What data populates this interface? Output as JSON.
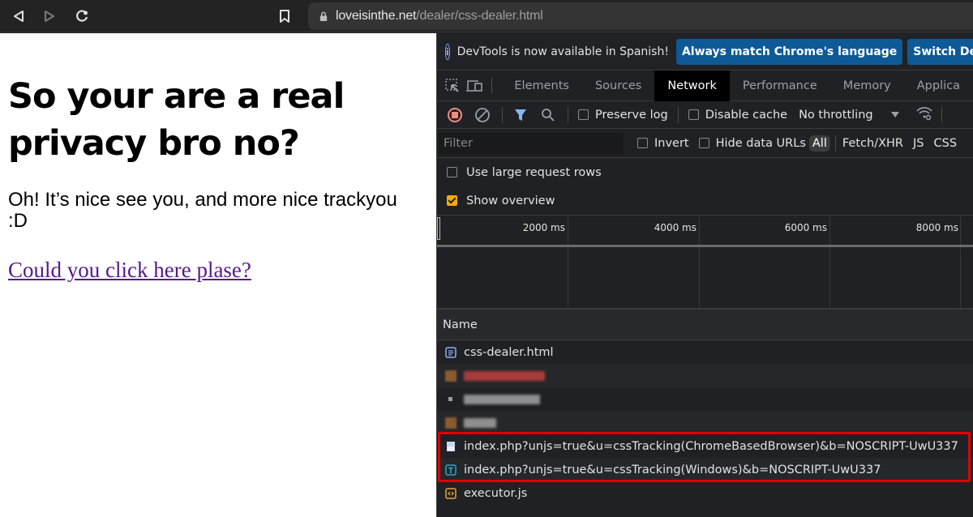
{
  "browser": {
    "url_host": "loveisinthe.net",
    "url_path": "/dealer/css-dealer.html",
    "icons": [
      "back-icon",
      "forward-icon",
      "reload-icon",
      "bookmark-icon",
      "lock-icon"
    ]
  },
  "page": {
    "heading": "So your are a real privacy bro no?",
    "paragraph": "Oh! It’s nice see you, and more nice trackyou :D",
    "link": "Could you click here plase?"
  },
  "devtools": {
    "infobar": {
      "message": "DevTools is now available in Spanish!",
      "btn_match": "Always match Chrome's language",
      "btn_switch": "Switch De"
    },
    "tabs": [
      {
        "label": "Elements"
      },
      {
        "label": "Sources"
      },
      {
        "label": "Network",
        "active": true
      },
      {
        "label": "Performance"
      },
      {
        "label": "Memory"
      },
      {
        "label": "Applica"
      }
    ],
    "toolbar": {
      "preserve_log": "Preserve log",
      "preserve_log_checked": false,
      "disable_cache": "Disable cache",
      "disable_cache_checked": false,
      "throttling": "No throttling"
    },
    "filter": {
      "placeholder": "Filter",
      "invert": "Invert",
      "hide_data_urls": "Hide data URLs",
      "types": [
        "All",
        "Fetch/XHR",
        "JS",
        "CSS"
      ],
      "active_type": "All"
    },
    "settings": {
      "large_rows": "Use large request rows",
      "large_rows_checked": false,
      "show_overview": "Show overview",
      "show_overview_checked": true
    },
    "overview": {
      "ticks": [
        "2000 ms",
        "4000 ms",
        "6000 ms",
        "8000 ms"
      ]
    },
    "table": {
      "name_header": "Name",
      "requests": [
        {
          "name": "css-dealer.html",
          "type": "document",
          "icon_color": "#8ab4f8",
          "blurred": false
        },
        {
          "name": "",
          "type": "image",
          "icon_color": "#a0693a",
          "blurred": true,
          "blur_color": "#b03a3a"
        },
        {
          "name": "",
          "type": "other",
          "icon_color": "#9a9a9a",
          "blurred": true,
          "blur_color": "#9a9a9a"
        },
        {
          "name": "",
          "type": "image",
          "icon_color": "#a0693a",
          "blurred": true,
          "blur_color": "#9a9a9a"
        },
        {
          "name": "index.php?unjs=true&u=cssTracking(ChromeBasedBrowser)&b=NOSCRIPT-UwU337",
          "type": "image",
          "icon_color": "#c8d6f0",
          "blurred": false,
          "highlighted": true
        },
        {
          "name": "index.php?unjs=true&u=cssTracking(Windows)&b=NOSCRIPT-UwU337",
          "type": "font",
          "icon_color": "#2fa4c9",
          "blurred": false,
          "highlighted": true
        },
        {
          "name": "executor.js",
          "type": "script",
          "icon_color": "#e8a33d",
          "blurred": false
        }
      ]
    },
    "colors": {
      "highlight_border": "#e00000",
      "button_blue": "#0e5a96",
      "checkbox_checked": "#f9ab00",
      "record_red": "#f28b82",
      "filter_blue": "#8ab4f8"
    }
  }
}
